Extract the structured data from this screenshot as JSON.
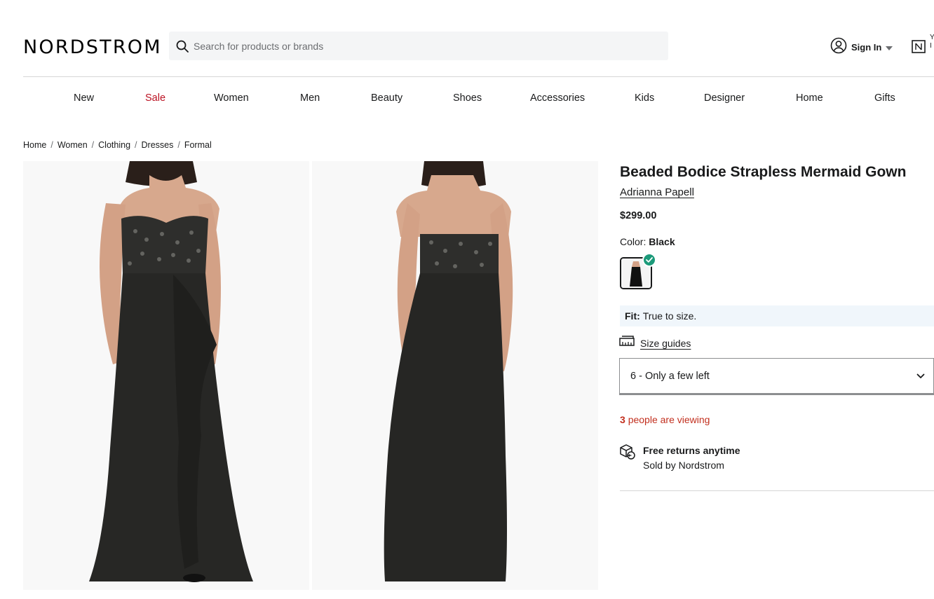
{
  "header": {
    "logo": "NORDSTROM",
    "search_placeholder": "Search for products or brands",
    "sign_in": "Sign In"
  },
  "nav": {
    "items": [
      "New",
      "Sale",
      "Women",
      "Men",
      "Beauty",
      "Shoes",
      "Accessories",
      "Kids",
      "Designer",
      "Home",
      "Gifts"
    ]
  },
  "breadcrumb": [
    "Home",
    "Women",
    "Clothing",
    "Dresses",
    "Formal"
  ],
  "product": {
    "title": "Beaded Bodice Strapless Mermaid Gown",
    "brand": "Adrianna Papell",
    "price": "$299.00",
    "color_label": "Color:",
    "color_value": "Black",
    "fit_label": "Fit:",
    "fit_value": "True to size.",
    "size_guides": "Size guides",
    "selected_size": "6 - Only a few left",
    "viewing_count": "3",
    "viewing_text": "people are viewing",
    "returns_title": "Free returns anytime",
    "sold_by": "Sold by Nordstrom"
  },
  "colors": {
    "sale_red": "#bb1122",
    "viewing_red": "#c22f1e",
    "check_green": "#1c9a7a",
    "fit_bg": "#f0f6fb"
  }
}
